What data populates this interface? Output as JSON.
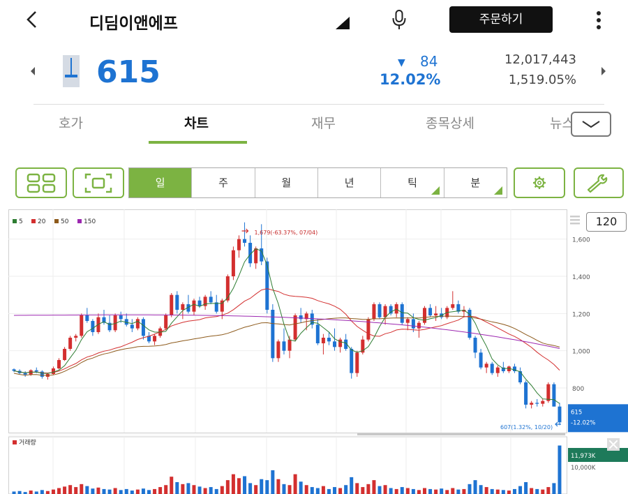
{
  "header": {
    "title": "디딤이앤에프",
    "order_button": "주문하기"
  },
  "quote": {
    "price": "615",
    "change_arrow": "▼",
    "change": "84",
    "change_pct": "12.02%",
    "volume": "12,017,443",
    "volume_pct": "1,519.05%"
  },
  "tabs": [
    {
      "label": "호가"
    },
    {
      "label": "차트"
    },
    {
      "label": "재무"
    },
    {
      "label": "종목상세"
    },
    {
      "label": "뉴스"
    }
  ],
  "toolbar": {
    "periods": [
      {
        "label": "일",
        "has_menu": false
      },
      {
        "label": "주",
        "has_menu": false
      },
      {
        "label": "월",
        "has_menu": false
      },
      {
        "label": "년",
        "has_menu": false
      },
      {
        "label": "틱",
        "has_menu": true
      },
      {
        "label": "분",
        "has_menu": true
      }
    ],
    "active_period": "일",
    "zoom_count": "120"
  },
  "colors": {
    "up": "#d32f2f",
    "down": "#1e73d2",
    "accent": "#7cb342",
    "ma5": "#2e7d32",
    "ma20": "#d32f2f",
    "ma50": "#8d5a1b",
    "ma150": "#9c27b0"
  },
  "chart_data": {
    "type": "candlestick",
    "legend": [
      {
        "name": "5",
        "color": "#2e7d32"
      },
      {
        "name": "20",
        "color": "#d32f2f"
      },
      {
        "name": "50",
        "color": "#8d5a1b"
      },
      {
        "name": "150",
        "color": "#9c27b0"
      }
    ],
    "y_ticks": [
      "1,600",
      "1,400",
      "1,200",
      "1,000",
      "800"
    ],
    "ylim": [
      560,
      1760
    ],
    "high_annotation": "1,679(-63.37%, 07/04)",
    "low_annotation": "607(1.32%, 10/20)",
    "current_price_label": "615",
    "current_change_label": "-12.02%",
    "volume_label": "거래량",
    "volume_current_label": "11,973K",
    "volume_tick": "10,000K",
    "candles": [
      [
        900,
        905,
        885,
        892
      ],
      [
        892,
        900,
        875,
        880
      ],
      [
        880,
        890,
        860,
        872
      ],
      [
        872,
        900,
        865,
        895
      ],
      [
        895,
        910,
        880,
        888
      ],
      [
        888,
        895,
        850,
        860
      ],
      [
        860,
        880,
        845,
        875
      ],
      [
        875,
        915,
        870,
        905
      ],
      [
        905,
        960,
        900,
        950
      ],
      [
        950,
        1020,
        945,
        1010
      ],
      [
        1010,
        1080,
        1000,
        1070
      ],
      [
        1070,
        1090,
        1050,
        1080
      ],
      [
        1080,
        1200,
        1070,
        1190
      ],
      [
        1190,
        1230,
        1150,
        1160
      ],
      [
        1160,
        1170,
        1080,
        1100
      ],
      [
        1100,
        1200,
        1090,
        1180
      ],
      [
        1180,
        1220,
        1140,
        1150
      ],
      [
        1150,
        1190,
        1100,
        1110
      ],
      [
        1110,
        1200,
        1100,
        1190
      ],
      [
        1190,
        1210,
        1150,
        1170
      ],
      [
        1170,
        1200,
        1130,
        1140
      ],
      [
        1140,
        1170,
        1100,
        1120
      ],
      [
        1120,
        1180,
        1110,
        1170
      ],
      [
        1170,
        1180,
        1060,
        1080
      ],
      [
        1080,
        1100,
        1040,
        1050
      ],
      [
        1050,
        1090,
        1030,
        1080
      ],
      [
        1080,
        1130,
        1070,
        1120
      ],
      [
        1120,
        1200,
        1110,
        1190
      ],
      [
        1190,
        1310,
        1180,
        1300
      ],
      [
        1300,
        1320,
        1200,
        1220
      ],
      [
        1220,
        1260,
        1170,
        1250
      ],
      [
        1250,
        1300,
        1200,
        1210
      ],
      [
        1210,
        1280,
        1190,
        1270
      ],
      [
        1270,
        1290,
        1230,
        1240
      ],
      [
        1240,
        1300,
        1220,
        1290
      ],
      [
        1290,
        1320,
        1250,
        1260
      ],
      [
        1260,
        1300,
        1200,
        1210
      ],
      [
        1210,
        1280,
        1170,
        1270
      ],
      [
        1270,
        1410,
        1260,
        1400
      ],
      [
        1400,
        1560,
        1380,
        1540
      ],
      [
        1540,
        1620,
        1500,
        1600
      ],
      [
        1600,
        1690,
        1560,
        1580
      ],
      [
        1580,
        1620,
        1450,
        1470
      ],
      [
        1470,
        1560,
        1440,
        1550
      ],
      [
        1550,
        1680,
        1460,
        1480
      ],
      [
        1480,
        1500,
        1200,
        1220
      ],
      [
        1220,
        1250,
        940,
        960
      ],
      [
        960,
        1060,
        940,
        1050
      ],
      [
        1050,
        1120,
        980,
        1000
      ],
      [
        1000,
        1080,
        960,
        1060
      ],
      [
        1060,
        1200,
        1050,
        1190
      ],
      [
        1190,
        1230,
        1150,
        1170
      ],
      [
        1170,
        1210,
        1110,
        1200
      ],
      [
        1200,
        1220,
        1120,
        1140
      ],
      [
        1140,
        1170,
        1030,
        1040
      ],
      [
        1040,
        1090,
        980,
        1070
      ],
      [
        1070,
        1100,
        1030,
        1050
      ],
      [
        1050,
        1120,
        1000,
        1020
      ],
      [
        1020,
        1070,
        990,
        1060
      ],
      [
        1060,
        1090,
        1000,
        1010
      ],
      [
        1010,
        1020,
        850,
        880
      ],
      [
        880,
        1000,
        860,
        990
      ],
      [
        990,
        1080,
        980,
        1060
      ],
      [
        1060,
        1180,
        1050,
        1170
      ],
      [
        1170,
        1260,
        1160,
        1250
      ],
      [
        1250,
        1260,
        1170,
        1180
      ],
      [
        1180,
        1250,
        1140,
        1240
      ],
      [
        1240,
        1250,
        1190,
        1200
      ],
      [
        1200,
        1260,
        1180,
        1250
      ],
      [
        1250,
        1260,
        1140,
        1150
      ],
      [
        1150,
        1180,
        1110,
        1170
      ],
      [
        1170,
        1200,
        1100,
        1120
      ],
      [
        1120,
        1160,
        1070,
        1150
      ],
      [
        1150,
        1240,
        1140,
        1230
      ],
      [
        1230,
        1250,
        1180,
        1190
      ],
      [
        1190,
        1240,
        1160,
        1200
      ],
      [
        1200,
        1230,
        1170,
        1180
      ],
      [
        1180,
        1240,
        1170,
        1230
      ],
      [
        1230,
        1320,
        1220,
        1250
      ],
      [
        1250,
        1270,
        1200,
        1210
      ],
      [
        1210,
        1240,
        1180,
        1220
      ],
      [
        1220,
        1230,
        1060,
        1070
      ],
      [
        1070,
        1080,
        960,
        990
      ],
      [
        990,
        1010,
        900,
        910
      ],
      [
        910,
        940,
        880,
        930
      ],
      [
        930,
        940,
        870,
        880
      ],
      [
        880,
        920,
        860,
        910
      ],
      [
        910,
        940,
        880,
        890
      ],
      [
        890,
        920,
        880,
        915
      ],
      [
        915,
        930,
        880,
        890
      ],
      [
        890,
        910,
        820,
        830
      ],
      [
        830,
        840,
        690,
        710
      ],
      [
        710,
        730,
        690,
        720
      ],
      [
        720,
        740,
        700,
        715
      ],
      [
        715,
        740,
        700,
        730
      ],
      [
        730,
        830,
        720,
        820
      ],
      [
        820,
        830,
        700,
        700
      ],
      [
        700,
        720,
        600,
        615
      ]
    ],
    "volumes": [
      5,
      6,
      4,
      7,
      5,
      8,
      6,
      9,
      12,
      15,
      18,
      14,
      20,
      16,
      11,
      13,
      10,
      9,
      12,
      8,
      10,
      7,
      9,
      11,
      8,
      10,
      14,
      18,
      35,
      24,
      20,
      22,
      18,
      15,
      12,
      14,
      10,
      16,
      28,
      40,
      32,
      36,
      22,
      18,
      30,
      28,
      48,
      30,
      20,
      18,
      40,
      25,
      18,
      14,
      12,
      16,
      10,
      14,
      12,
      18,
      34,
      22,
      14,
      20,
      28,
      16,
      18,
      12,
      10,
      14,
      12,
      10,
      8,
      12,
      10,
      9,
      11,
      8,
      12,
      9,
      10,
      20,
      28,
      18,
      14,
      10,
      9,
      8,
      7,
      10,
      16,
      24,
      12,
      10,
      9,
      14,
      22,
      98
    ]
  }
}
